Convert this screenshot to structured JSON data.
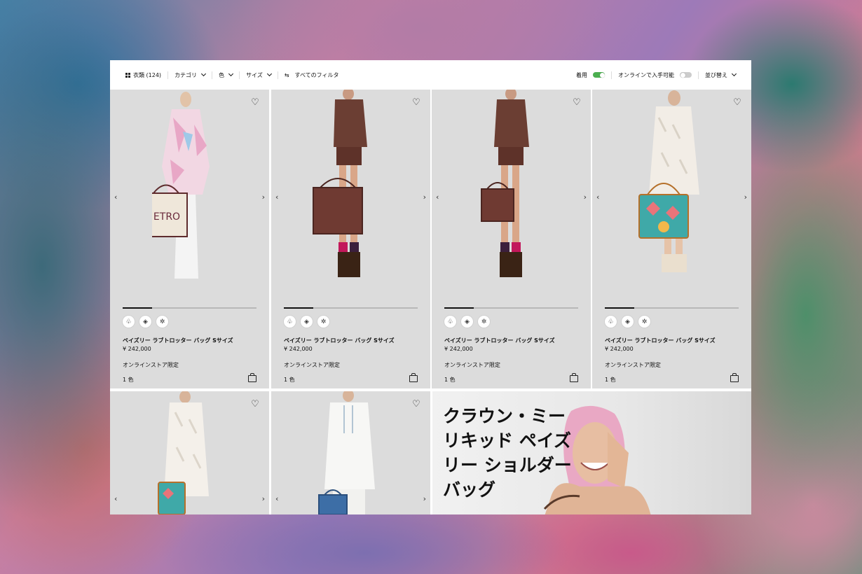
{
  "filterbar": {
    "category_count": "衣類 (124)",
    "category": "カテゴリ",
    "color": "色",
    "size": "サイズ",
    "all_filters": "すべてのフィルタ",
    "wearing": "着用",
    "online_available": "オンラインで入手可能",
    "sort": "並び替え",
    "wearing_toggle_on": true,
    "online_toggle_on": false
  },
  "products": [
    {
      "name": "ペイズリー ラブトロッター バッグ Sサイズ",
      "price": "¥ 242,000",
      "note": "オンラインストア限定",
      "colors": "1 色",
      "progress": 0.22
    },
    {
      "name": "ペイズリー ラブトロッター バッグ Sサイズ",
      "price": "¥ 242,000",
      "note": "オンラインストア限定",
      "colors": "1 色",
      "progress": 0.22
    },
    {
      "name": "ペイズリー ラブトロッター バッグ Sサイズ",
      "price": "¥ 242,000",
      "note": "オンラインストア限定",
      "colors": "1 色",
      "progress": 0.22
    },
    {
      "name": "ペイズリー ラブトロッター バッグ Sサイズ",
      "price": "¥ 242,000",
      "note": "オンラインストア限定",
      "colors": "1 色",
      "progress": 0.22
    }
  ],
  "promo": {
    "line1": "クラウン・ミー",
    "line2": "リキッド ペイズ",
    "line3": "リー ショルダー",
    "line4": "バッグ"
  },
  "icons": {
    "favorite": "heart-icon",
    "prev": "chevron-left-icon",
    "next": "chevron-right-icon",
    "cart": "shopping-bag-icon"
  }
}
